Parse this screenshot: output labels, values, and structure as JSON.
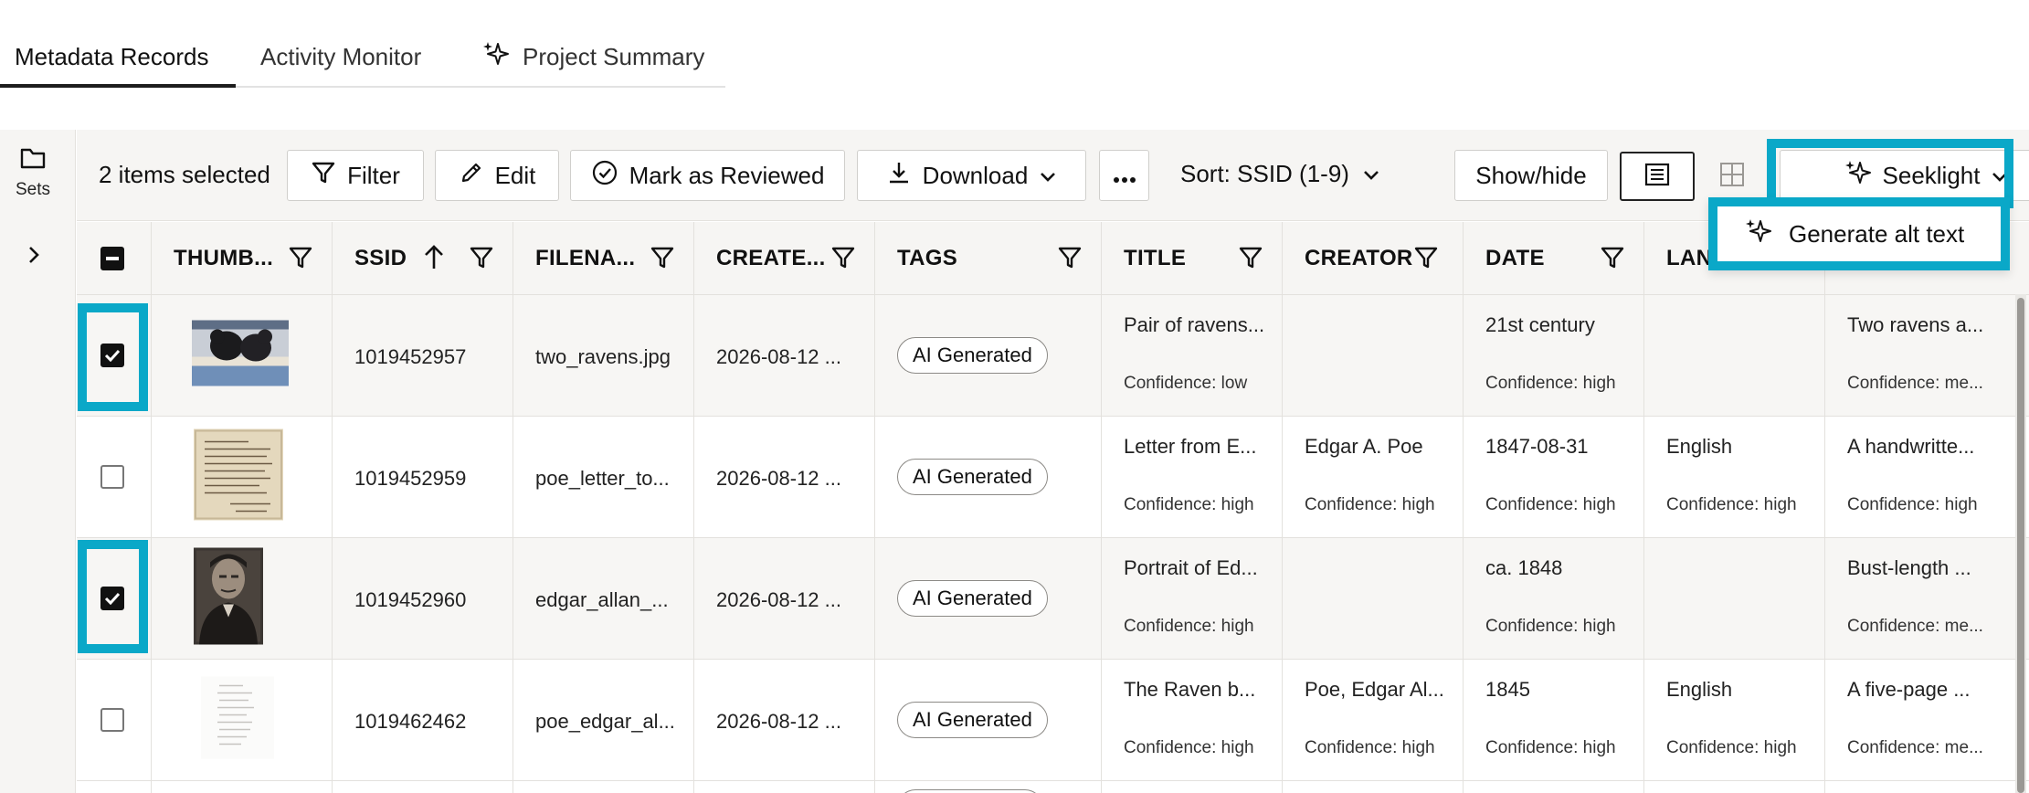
{
  "tabs": [
    {
      "label": "Metadata Records",
      "active": true
    },
    {
      "label": "Activity Monitor",
      "active": false
    },
    {
      "label": "Project Summary",
      "active": false,
      "icon": "sparkle-icon"
    }
  ],
  "sidebar": {
    "sets_label": "Sets",
    "icon": "folder-icon",
    "expand_icon": "chevron-right-icon"
  },
  "toolbar": {
    "selected_count": "2 items selected",
    "filter_label": "Filter",
    "edit_label": "Edit",
    "mark_reviewed_label": "Mark as Reviewed",
    "download_label": "Download",
    "sort_label": "Sort: SSID (1-9)",
    "showhide_label": "Show/hide",
    "seeklight_label": "Seeklight"
  },
  "seeklight_menu": {
    "items": [
      {
        "label": "Generate alt text",
        "icon": "sparkle-icon"
      }
    ]
  },
  "columns": [
    "THUMB...",
    "SSID",
    "FILENA...",
    "CREATE...",
    "TAGS",
    "TITLE",
    "CREATOR",
    "DATE",
    "LAN"
  ],
  "rows": [
    {
      "selected": true,
      "thumb": "ravens",
      "ssid": "1019452957",
      "filename": "two_ravens.jpg",
      "created": "2026-08-12 ...",
      "tag": "AI Generated",
      "title": "Pair of ravens...",
      "title_conf": "Confidence: low",
      "creator": "",
      "creator_conf": "",
      "date": "21st century",
      "date_conf": "Confidence: high",
      "language": "",
      "language_conf": "",
      "desc": "Two ravens a...",
      "desc_conf": "Confidence: me..."
    },
    {
      "selected": false,
      "thumb": "letter",
      "ssid": "1019452959",
      "filename": "poe_letter_to...",
      "created": "2026-08-12 ...",
      "tag": "AI Generated",
      "title": "Letter from E...",
      "title_conf": "Confidence: high",
      "creator": "Edgar A. Poe",
      "creator_conf": "Confidence: high",
      "date": "1847-08-31",
      "date_conf": "Confidence: high",
      "language": "English",
      "language_conf": "Confidence: high",
      "desc": "A handwritte...",
      "desc_conf": "Confidence: high"
    },
    {
      "selected": true,
      "thumb": "portrait",
      "ssid": "1019452960",
      "filename": "edgar_allan_...",
      "created": "2026-08-12 ...",
      "tag": "AI Generated",
      "title": "Portrait of Ed...",
      "title_conf": "Confidence: high",
      "creator": "",
      "creator_conf": "",
      "date": "ca. 1848",
      "date_conf": "Confidence: high",
      "language": "",
      "language_conf": "",
      "desc": "Bust-length ...",
      "desc_conf": "Confidence: me..."
    },
    {
      "selected": false,
      "thumb": "document",
      "ssid": "1019462462",
      "filename": "poe_edgar_al...",
      "created": "2026-08-12 ...",
      "tag": "AI Generated",
      "title": "The Raven b...",
      "title_conf": "Confidence: high",
      "creator": "Poe, Edgar Al...",
      "creator_conf": "Confidence: high",
      "date": "1845",
      "date_conf": "Confidence: high",
      "language": "English",
      "language_conf": "Confidence: high",
      "desc": "A five-page ...",
      "desc_conf": "Confidence: me..."
    }
  ],
  "colors": {
    "highlight": "#0aa8c8",
    "panel": "#f6f5f3"
  }
}
